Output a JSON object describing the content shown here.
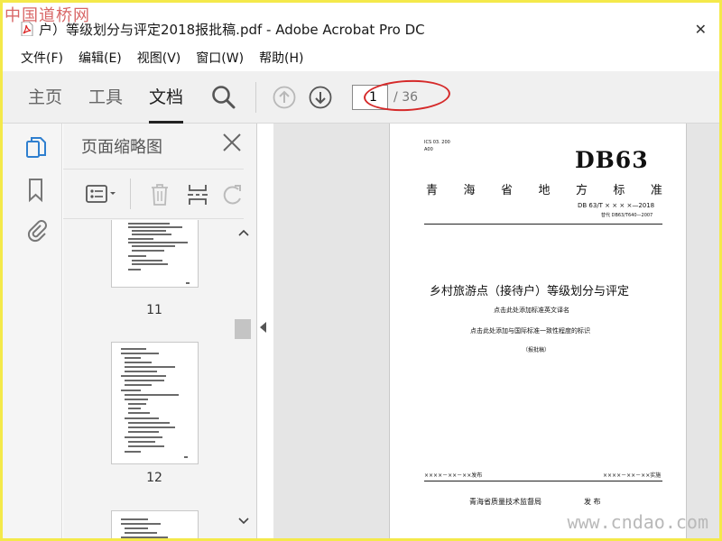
{
  "watermarks": {
    "top": "中国道桥网",
    "bottom": "www.cndao.com"
  },
  "window": {
    "title": "户）等级划分与评定2018报批稿.pdf - Adobe Acrobat Pro DC",
    "close": "✕"
  },
  "menu": [
    "文件(F)",
    "编辑(E)",
    "视图(V)",
    "窗口(W)",
    "帮助(H)"
  ],
  "toolbar": {
    "tabs": [
      {
        "label": "主页",
        "active": false
      },
      {
        "label": "工具",
        "active": false
      },
      {
        "label": "文档",
        "active": true
      }
    ],
    "page_current": "1",
    "page_total": "/ 36"
  },
  "panel": {
    "title": "页面缩略图",
    "thumbnails": [
      {
        "label": "11",
        "page": 11
      },
      {
        "label": "12",
        "page": 12
      }
    ]
  },
  "document": {
    "ics": "ICS  03. 200",
    "ccs": "A00",
    "code": "DB63",
    "region": [
      "青",
      "海",
      "省",
      "地",
      "方",
      "标",
      "准"
    ],
    "std_number": "DB 63/T  × × × ×—2018",
    "replaces": "替代 DB63/T640—2007",
    "title_cn": "乡村旅游点（接待户）等级划分与评定",
    "title_en_placeholder": "点击此处添加标准英文译名",
    "consistency_placeholder": "点击此处添加与国际标准一致性程度的标识",
    "draft_stage": "（报批稿）",
    "issue_date": "××××－××－××发布",
    "impl_date": "××××－××－××实施",
    "issuer": "青海省质量技术监督局",
    "issue_word": "发 布"
  },
  "colors": {
    "accent_blue": "#2f7fcf",
    "annotation_red": "#d52a2a",
    "outer_border": "#f4e94a"
  }
}
